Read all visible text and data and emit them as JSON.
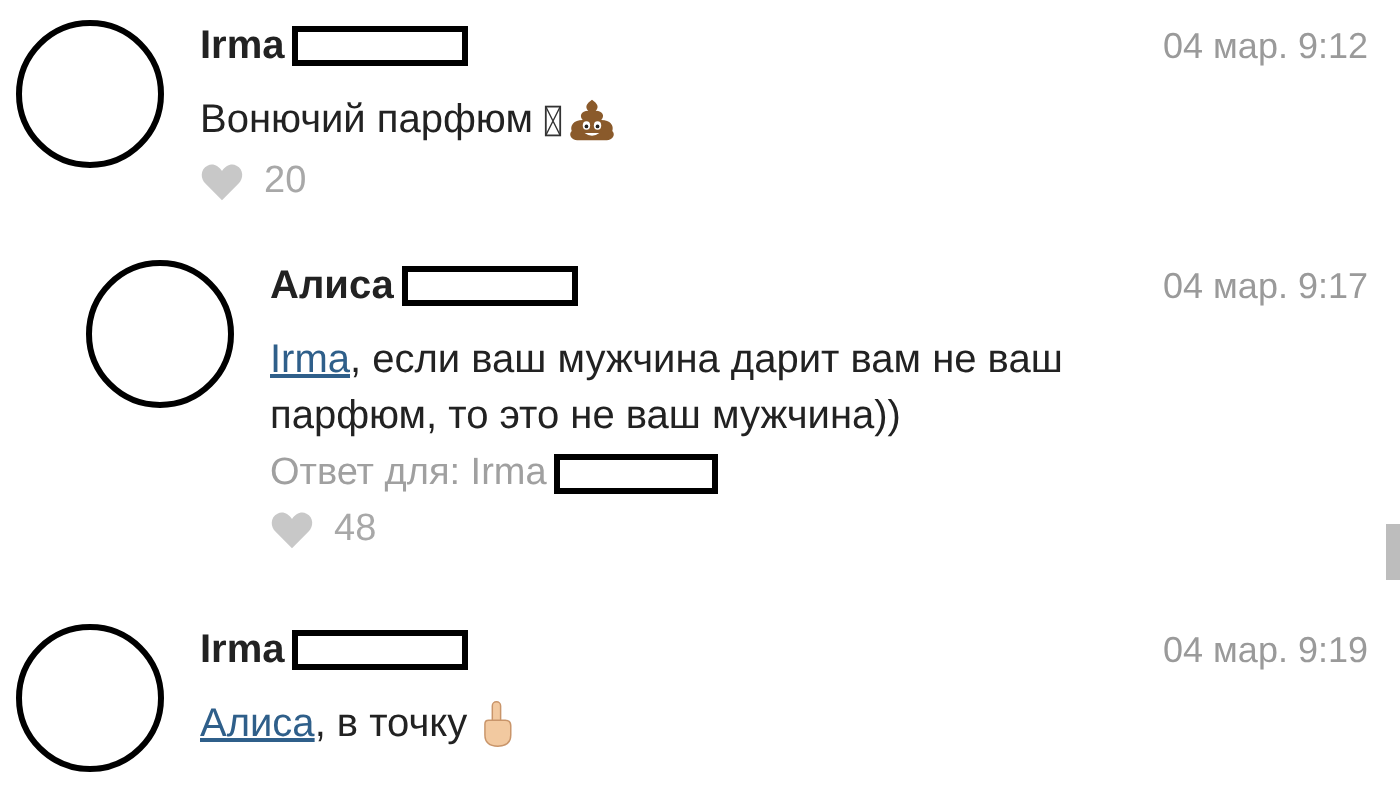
{
  "comments": [
    {
      "reply": false,
      "author": "Irma",
      "time": "04 мар. 9:12",
      "text": "Вонючий парфюм",
      "icons": [
        {
          "kind": "tofu"
        },
        {
          "kind": "poop"
        }
      ],
      "likes": {
        "count": "20",
        "liked": false
      }
    },
    {
      "reply": true,
      "author": "Алиса",
      "time": "04 мар. 9:17",
      "mention": "Irma",
      "text": ", если ваш мужчина дарит вам не ваш парфюм, то это не ваш мужчина))",
      "reply_to": "Ответ для: Irma",
      "likes": {
        "count": "48",
        "liked": false
      }
    },
    {
      "reply": false,
      "author": "Irma",
      "time": "04 мар. 9:19",
      "mention": "Алиса",
      "text": ", в точку",
      "icons": [
        {
          "kind": "finger"
        }
      ]
    }
  ]
}
